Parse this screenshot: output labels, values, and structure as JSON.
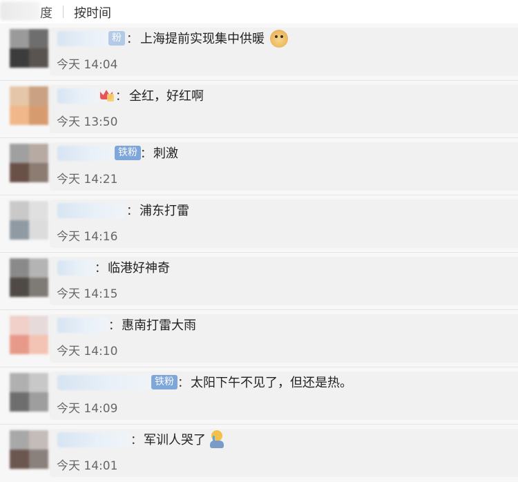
{
  "header": {
    "sort_hot": "度",
    "sort_time": "按时间"
  },
  "colors": {
    "badge": "#6b9ad6",
    "card": "#f1f1f1",
    "name_blur": "#d6e4f2"
  },
  "comments": [
    {
      "badge": "粉",
      "text": "上海提前实现集中供暖",
      "time": "今天 14:04",
      "emoji": "doge-icon"
    },
    {
      "badge": "",
      "text": "全红，好红啊",
      "time": "今天 13:50",
      "emoji": "crown-icon"
    },
    {
      "badge": "铁粉",
      "text": "刺激",
      "time": "今天 14:21",
      "emoji": ""
    },
    {
      "badge": "",
      "text": "浦东打雷",
      "time": "今天 14:16",
      "emoji": ""
    },
    {
      "badge": "",
      "text": "临港好神奇",
      "time": "今天 14:15",
      "emoji": ""
    },
    {
      "badge": "",
      "text": "惠南打雷大雨",
      "time": "今天 14:10",
      "emoji": ""
    },
    {
      "badge": "铁粉",
      "text": "太阳下午不见了，但还是热。",
      "time": "今天 14:09",
      "emoji": ""
    },
    {
      "badge": "",
      "text": "军训人哭了",
      "time": "今天 14:01",
      "emoji": "crying-icon"
    }
  ]
}
